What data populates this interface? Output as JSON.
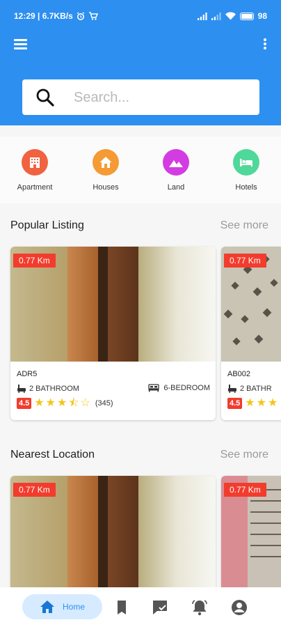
{
  "status_bar": {
    "time_speed": "12:29 | 6.7KB/s",
    "battery": "98"
  },
  "search": {
    "placeholder": "Search..."
  },
  "categories": [
    {
      "label": "Apartment",
      "color": "#f06240",
      "icon": "building-icon"
    },
    {
      "label": "Houses",
      "color": "#f59a35",
      "icon": "house-icon"
    },
    {
      "label": "Land",
      "color": "#d33ce2",
      "icon": "landscape-icon"
    },
    {
      "label": "Hotels",
      "color": "#4fd89a",
      "icon": "hotel-bed-icon"
    }
  ],
  "popular": {
    "title": "Popular Listing",
    "see_more": "See more",
    "cards": [
      {
        "distance": "0.77 Km",
        "code": "ADR5",
        "bathroom": "2 BATHROOM",
        "bedroom": "6-BEDROOM",
        "rating": "4.5",
        "stars": 4.5,
        "count": "(345)"
      },
      {
        "distance": "0.77 Km",
        "code": "AB002",
        "bathroom": "2 BATHR",
        "rating": "4.5",
        "stars": 4.5
      }
    ]
  },
  "nearest": {
    "title": "Nearest Location",
    "see_more": "See more",
    "cards": [
      {
        "distance": "0.77 Km"
      },
      {
        "distance": "0.77 Km"
      }
    ]
  },
  "nav": {
    "home_label": "Home"
  },
  "colors": {
    "primary": "#2d8ff0",
    "badge": "#f23c2d",
    "star": "#f5c518"
  }
}
